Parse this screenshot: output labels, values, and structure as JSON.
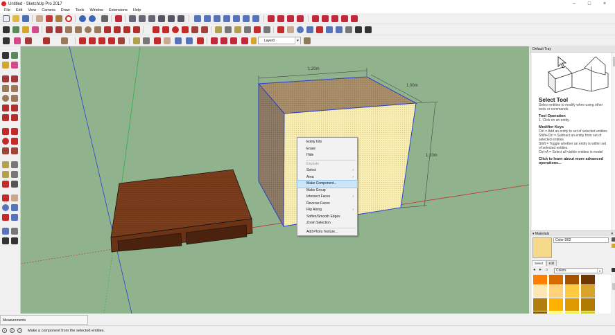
{
  "window": {
    "title": "Untitled - SketchUp Pro 2017",
    "minimize": "–",
    "maximize": "□",
    "close": "×"
  },
  "menu": [
    "File",
    "Edit",
    "View",
    "Camera",
    "Draw",
    "Tools",
    "Window",
    "Extensions",
    "Help"
  ],
  "toolbar": {
    "layer_value": "Layer0",
    "layer_dropdown": "▾"
  },
  "viewport": {
    "dimensions": {
      "width": "1.20m",
      "depth": "1.00m",
      "height": "1.10m"
    },
    "colors": {
      "ground": "#90b38d",
      "box_front": "#f8eeb1",
      "box_top": "#a98f69",
      "box_side": "#8e7c66",
      "wood": "#7c3e1c"
    }
  },
  "context_menu": {
    "items": [
      {
        "label": "Entity Info"
      },
      {
        "label": "Erase"
      },
      {
        "label": "Hide"
      },
      {
        "separator": true
      },
      {
        "label": "Explode",
        "disabled": true
      },
      {
        "label": "Select",
        "submenu": true
      },
      {
        "label": "Area",
        "submenu": true
      },
      {
        "label": "Make Component...",
        "highlighted": true
      },
      {
        "label": "Make Group"
      },
      {
        "label": "Intersect Faces",
        "submenu": true
      },
      {
        "label": "Reverse Faces"
      },
      {
        "label": "Flip Along",
        "submenu": true
      },
      {
        "label": "Soften/Smooth Edges"
      },
      {
        "label": "Zoom Selection"
      },
      {
        "separator": true
      },
      {
        "label": "Add Photo Texture..."
      }
    ],
    "submenu_arrow": "›"
  },
  "tray": {
    "title": "Default Tray",
    "instructor": {
      "title": "Select Tool",
      "subtitle": "Select entities to modify when using other tools or commands.",
      "op_heading": "Tool Operation",
      "op_text": "1. Click on an entity.",
      "mod_heading": "Modifier Keys",
      "mod_lines": [
        "Ctrl = Add an entity to set of selected entities",
        "Shift+Ctrl = Subtract an entity from set of selected entities",
        "Shift = Toggle whether an entity is within set of selected entities",
        "Ctrl+A = Select all visible entities in model"
      ],
      "learn_more": "Click to learn about more advanced operations..."
    },
    "materials": {
      "header": "▾ Materials",
      "close": "✕",
      "material_name": "Color D02",
      "tabs": [
        "Select",
        "Edit"
      ],
      "library": "Colors",
      "library_dropdown": "▾",
      "nav_icons": [
        "◂",
        "▸",
        "⌂"
      ],
      "swatches": [
        "#f6d88b",
        "#ff7f00",
        "#d46a00",
        "#a65300",
        "#6e3600",
        "#ffe7b3",
        "#ffd17a",
        "#ffc940",
        "#d9a22a",
        "#b07d10",
        "#ffb000",
        "#dd9a00",
        "#b07b00",
        "#805900",
        "#ffff7a",
        "#eded55",
        "#cccc2a",
        "#9c9c0a",
        "#ffff00",
        "#dcdc00",
        "#b0b000",
        "#858500"
      ]
    }
  },
  "measurements": {
    "label": "Measurements"
  },
  "status": {
    "text": "Make a component from the selected entities.",
    "icons": [
      "i",
      "©",
      "?"
    ]
  }
}
